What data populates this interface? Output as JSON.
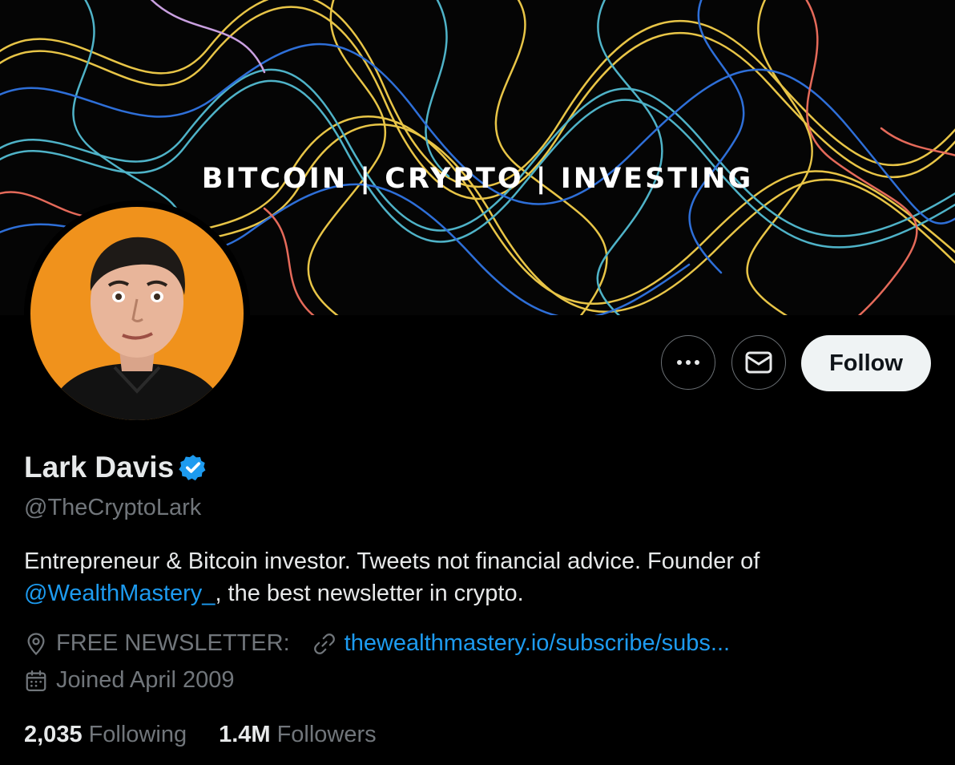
{
  "banner": {
    "text": "BITCOIN | CRYPTO | INVESTING"
  },
  "actions": {
    "more_icon": "more-horizontal-icon",
    "message_icon": "envelope-icon",
    "follow_label": "Follow"
  },
  "profile": {
    "name": "Lark Davis",
    "verified_icon": "verified-badge-icon",
    "handle": "@TheCryptoLark",
    "bio_part1": "Entrepreneur & Bitcoin investor. Tweets not financial advice. Founder of",
    "bio_mention": "@WealthMastery_",
    "bio_part2": ", the best newsletter in crypto.",
    "location": "FREE NEWSLETTER:",
    "website": "thewealthmastery.io/subscribe/subs...",
    "joined": "Joined April 2009"
  },
  "stats": {
    "following_count": "2,035",
    "following_label": "Following",
    "followers_count": "1.4M",
    "followers_label": "Followers"
  },
  "colors": {
    "background": "#000000",
    "accent": "#1d9bf0",
    "muted": "#71767b",
    "avatar_bg": "#f0921c"
  }
}
